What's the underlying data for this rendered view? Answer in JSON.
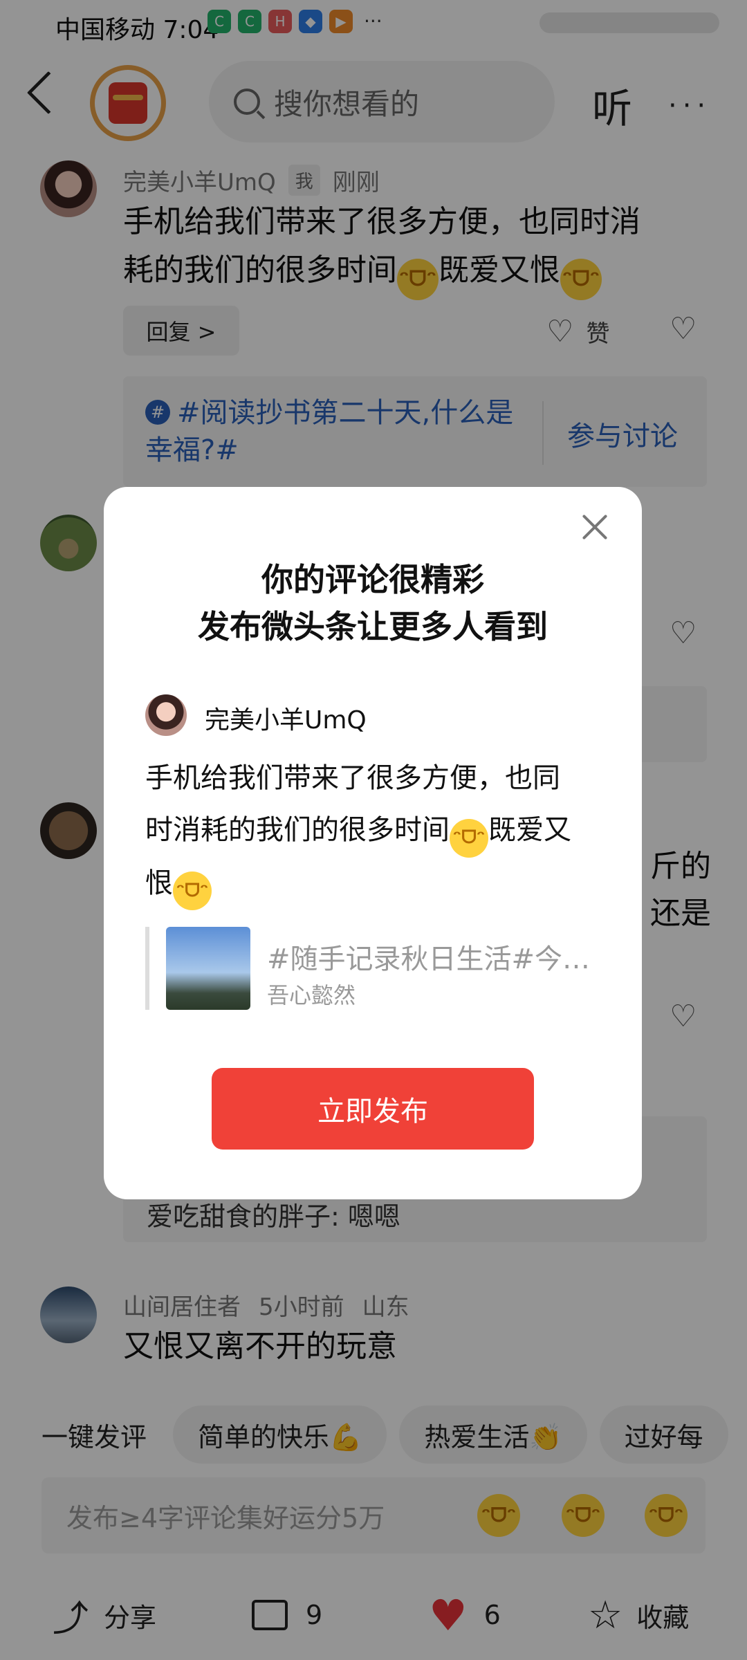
{
  "status_bar": {
    "carrier_time": "中国移动 7:04",
    "more": "···"
  },
  "header": {
    "search_placeholder": "搜你想看的",
    "listen_label": "听",
    "more_label": "···"
  },
  "comment1": {
    "author": "完美小羊UmQ",
    "badge": "我",
    "time": "刚刚",
    "text_line1": "手机给我们带来了很多方便，也同时消",
    "text_line2a": "耗的我们的很多时间",
    "text_line2b": "既爱又恨",
    "reply_label": "回复 >",
    "like_label": "赞"
  },
  "topic": {
    "hash": "#",
    "text": "#阅读抄书第二十天,什么是幸福?#",
    "join_label": "参与讨论"
  },
  "partial": {
    "right_text1": "斤的",
    "right_text2": "还是",
    "reply_preview": "爱吃甜食的胖子: 嗯嗯"
  },
  "comment_last": {
    "author": "山间居住者",
    "time": "5小时前",
    "location": "山东",
    "text": "又恨又离不开的玩意"
  },
  "quick_comment": {
    "label": "一键发评",
    "chips": [
      "简单的快乐💪",
      "热爱生活👏",
      "过好每"
    ]
  },
  "input": {
    "placeholder": "发布≥4字评论集好运分5万"
  },
  "toolbar": {
    "share_label": "分享",
    "comment_count": "9",
    "like_count": "6",
    "favorite_label": "收藏"
  },
  "dialog": {
    "title_line1": "你的评论很精彩",
    "title_line2": "发布微头条让更多人看到",
    "author": "完美小羊UmQ",
    "body_line1": "手机给我们带来了很多方便，也同",
    "body_line2a": "时消耗的我们的很多时间",
    "body_line2b": "既爱又",
    "body_line3": "恨",
    "quote_title": "#随手记录秋日生活#今…",
    "quote_author": "吾心懿然",
    "publish_label": "立即发布"
  },
  "colors": {
    "accent_red": "#f04138",
    "link_blue": "#2a60b8",
    "like_red": "#e8333a"
  }
}
